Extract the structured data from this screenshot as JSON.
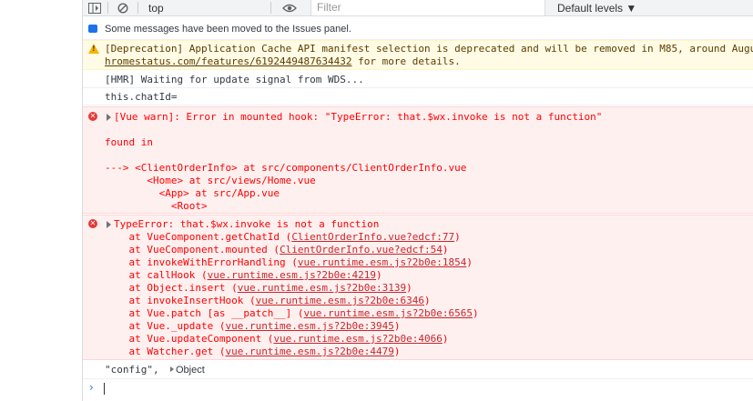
{
  "toolbar": {
    "context": "top",
    "filter_placeholder": "Filter",
    "levels": "Default levels ▼"
  },
  "messages": {
    "issues": "Some messages have been moved to the Issues panel.",
    "deprecation": {
      "line1": "[Deprecation] Application Cache API manifest selection is deprecated and will be removed in M85, around Augu",
      "link": "hromestatus.com/features/6192449487634432",
      "tail": " for more details."
    },
    "hmr": "[HMR] Waiting for update signal from WDS...",
    "chatid": "this.chatId=",
    "vue_warn": {
      "head": "[Vue warn]: Error in mounted hook: \"TypeError: that.$wx.invoke is not a function\"",
      "found_in": "found in",
      "trace": [
        "---> <ClientOrderInfo> at src/components/ClientOrderInfo.vue",
        "       <Home> at src/views/Home.vue",
        "         <App> at src/App.vue",
        "           <Root>"
      ]
    },
    "type_error": {
      "head": "TypeError: that.$wx.invoke is not a function",
      "frames": [
        {
          "at": "    at VueComponent.getChatId (",
          "link": "ClientOrderInfo.vue?edcf:77",
          "end": ")"
        },
        {
          "at": "    at VueComponent.mounted (",
          "link": "ClientOrderInfo.vue?edcf:54",
          "end": ")"
        },
        {
          "at": "    at invokeWithErrorHandling (",
          "link": "vue.runtime.esm.js?2b0e:1854",
          "end": ")"
        },
        {
          "at": "    at callHook (",
          "link": "vue.runtime.esm.js?2b0e:4219",
          "end": ")"
        },
        {
          "at": "    at Object.insert (",
          "link": "vue.runtime.esm.js?2b0e:3139",
          "end": ")"
        },
        {
          "at": "    at invokeInsertHook (",
          "link": "vue.runtime.esm.js?2b0e:6346",
          "end": ")"
        },
        {
          "at": "    at Vue.patch [as __patch__] (",
          "link": "vue.runtime.esm.js?2b0e:6565",
          "end": ")"
        },
        {
          "at": "    at Vue._update (",
          "link": "vue.runtime.esm.js?2b0e:3945",
          "end": ")"
        },
        {
          "at": "    at Vue.updateComponent (",
          "link": "vue.runtime.esm.js?2b0e:4066",
          "end": ")"
        },
        {
          "at": "    at Watcher.get (",
          "link": "vue.runtime.esm.js?2b0e:4479",
          "end": ")"
        }
      ]
    },
    "config_label": "\"config\", ",
    "object_label": "Object"
  }
}
